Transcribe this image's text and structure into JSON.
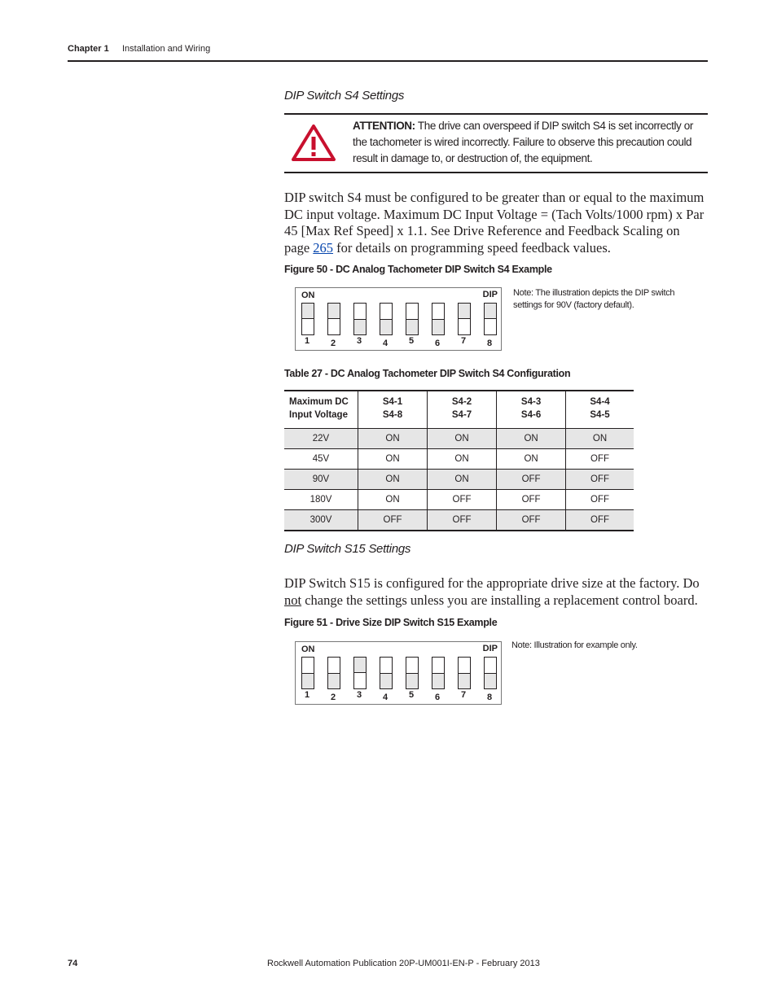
{
  "header": {
    "chapter": "Chapter 1",
    "section": "Installation and Wiring"
  },
  "s4": {
    "heading": "DIP Switch S4 Settings",
    "attention_label": "ATTENTION:",
    "attention_text": "The drive can overspeed if DIP switch S4 is set incorrectly or the tachometer is wired incorrectly. Failure to observe this precaution could result in damage to, or destruction of, the equipment.",
    "para_1": "DIP switch S4 must be configured to be greater than or equal to the maximum DC input voltage. Maximum DC Input Voltage = (Tach Volts/1000 rpm) x Par 45 [Max Ref Speed] x 1.1. See Drive Reference and Feedback Scaling on page ",
    "link": "265",
    "para_2": " for details on programming speed feedback values.",
    "figure_caption": "Figure 50 - DC Analog Tachometer DIP Switch S4 Example",
    "figure_note": "Note: The illustration depicts the DIP switch settings for 90V (factory default).",
    "switches": [
      true,
      true,
      false,
      false,
      false,
      false,
      true,
      true
    ]
  },
  "dip_labels": {
    "on": "ON",
    "dip": "DIP",
    "numbers": [
      "1",
      "2",
      "3",
      "4",
      "5",
      "6",
      "7",
      "8"
    ]
  },
  "table": {
    "caption": "Table 27 - DC Analog Tachometer DIP Switch S4 Configuration",
    "headers": [
      [
        "Maximum DC",
        "Input Voltage"
      ],
      [
        "S4-1",
        "S4-8"
      ],
      [
        "S4-2",
        "S4-7"
      ],
      [
        "S4-3",
        "S4-6"
      ],
      [
        "S4-4",
        "S4-5"
      ]
    ],
    "rows": [
      [
        "22V",
        "ON",
        "ON",
        "ON",
        "ON"
      ],
      [
        "45V",
        "ON",
        "ON",
        "ON",
        "OFF"
      ],
      [
        "90V",
        "ON",
        "ON",
        "OFF",
        "OFF"
      ],
      [
        "180V",
        "ON",
        "OFF",
        "OFF",
        "OFF"
      ],
      [
        "300V",
        "OFF",
        "OFF",
        "OFF",
        "OFF"
      ]
    ]
  },
  "s15": {
    "heading": "DIP Switch S15 Settings",
    "para_1": "DIP Switch S15 is configured for the appropriate drive size at the factory. Do ",
    "emph": "not",
    "para_2": " change the settings unless you are installing a replacement control board.",
    "figure_caption": "Figure 51 - Drive Size DIP Switch S15 Example",
    "figure_note": "Note: Illustration for example only.",
    "switches": [
      false,
      false,
      true,
      false,
      false,
      false,
      false,
      false
    ]
  },
  "footer": {
    "page": "74",
    "publication": "Rockwell Automation Publication 20P-UM001I-EN-P - February 2013"
  }
}
